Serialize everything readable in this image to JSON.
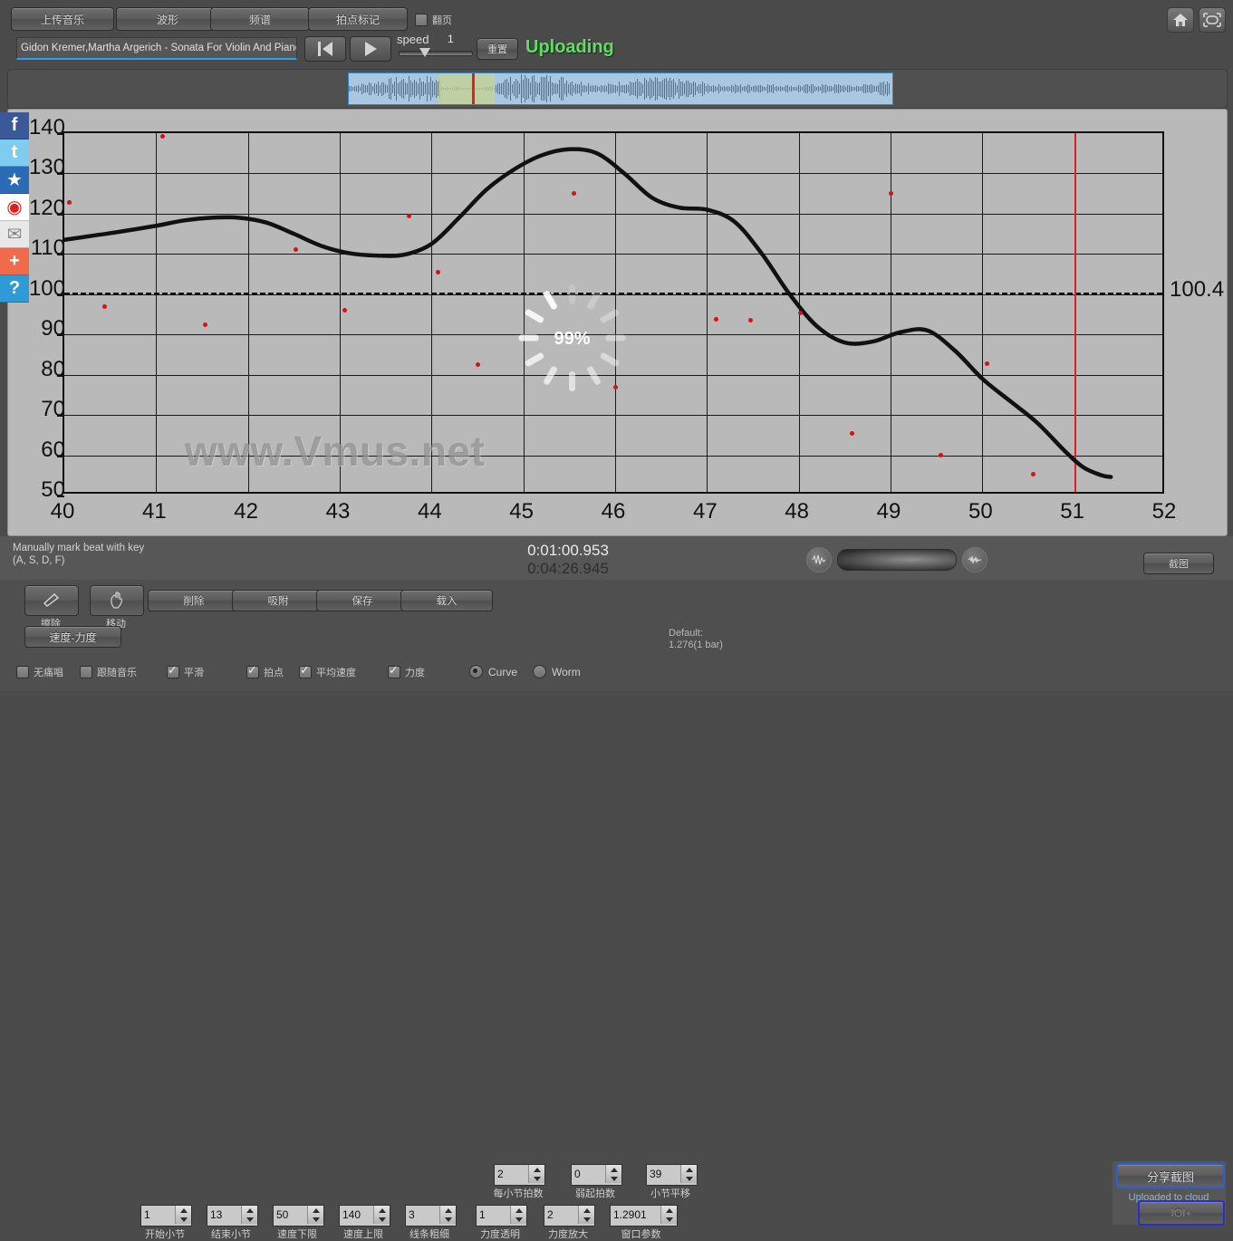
{
  "toolbar": {
    "buttons": [
      {
        "label": "上传音乐",
        "name": "upload-music-button"
      },
      {
        "label": "波形",
        "name": "waveform-button"
      },
      {
        "label": "频谱",
        "name": "spectrum-button"
      },
      {
        "label": "拍点标记",
        "name": "beat-mark-button"
      }
    ],
    "flip_page_checkbox": {
      "label": "翻页",
      "checked": false
    },
    "track_title": "Gidon Kremer,Martha Argerich - Sonata For Violin And Piano",
    "speed_label": "speed",
    "speed_value": "1",
    "reset_label": "重置",
    "status": "Uploading",
    "status_color": "#5ee05e",
    "home_icon": "home-icon",
    "fullscreen_icon": "fullscreen-icon"
  },
  "chart_data": {
    "type": "line",
    "title": "",
    "xlabel": "",
    "ylabel": "",
    "xlim": [
      40,
      52
    ],
    "ylim": [
      50,
      140
    ],
    "xticks": [
      40,
      41,
      42,
      43,
      44,
      45,
      46,
      47,
      48,
      49,
      50,
      51,
      52
    ],
    "yticks": [
      50,
      60,
      70,
      80,
      90,
      100,
      110,
      120,
      130,
      140
    ],
    "grid": true,
    "reference_line": {
      "value": 100.4,
      "label": "100.4",
      "style": "dashed"
    },
    "cursor_line": {
      "x": 51.0,
      "color": "#e02020"
    },
    "watermark": "www.Vmus.net",
    "progress_label": "99%",
    "series": [
      {
        "name": "tempo-curve",
        "type": "line",
        "color": "#111111",
        "points": [
          [
            40.0,
            113.5
          ],
          [
            40.3,
            114.5
          ],
          [
            40.6,
            115.5
          ],
          [
            41.0,
            117.0
          ],
          [
            41.3,
            118.3
          ],
          [
            41.6,
            119.0
          ],
          [
            41.9,
            119.0
          ],
          [
            42.2,
            117.8
          ],
          [
            42.5,
            115.0
          ],
          [
            42.8,
            112.0
          ],
          [
            43.1,
            110.2
          ],
          [
            43.4,
            109.6
          ],
          [
            43.7,
            109.8
          ],
          [
            44.0,
            112.5
          ],
          [
            44.3,
            119.0
          ],
          [
            44.6,
            126.0
          ],
          [
            44.9,
            131.0
          ],
          [
            45.2,
            134.5
          ],
          [
            45.5,
            136.0
          ],
          [
            45.8,
            135.0
          ],
          [
            46.1,
            130.0
          ],
          [
            46.4,
            124.0
          ],
          [
            46.7,
            121.5
          ],
          [
            47.0,
            121.0
          ],
          [
            47.3,
            118.0
          ],
          [
            47.6,
            110.0
          ],
          [
            47.9,
            100.0
          ],
          [
            48.2,
            92.0
          ],
          [
            48.5,
            88.0
          ],
          [
            48.8,
            88.2
          ],
          [
            49.1,
            90.5
          ],
          [
            49.4,
            91.0
          ],
          [
            49.7,
            86.0
          ],
          [
            50.0,
            79.0
          ],
          [
            50.3,
            73.5
          ],
          [
            50.6,
            68.0
          ],
          [
            50.9,
            61.0
          ],
          [
            51.1,
            57.0
          ],
          [
            51.3,
            55.0
          ],
          [
            51.4,
            54.6
          ]
        ]
      },
      {
        "name": "beat-points",
        "type": "scatter",
        "color": "#d81212",
        "points": [
          [
            40.05,
            122.8
          ],
          [
            40.44,
            97.0
          ],
          [
            41.07,
            139.2
          ],
          [
            41.53,
            92.5
          ],
          [
            42.52,
            111.0
          ],
          [
            43.05,
            96.0
          ],
          [
            43.75,
            119.5
          ],
          [
            44.07,
            105.5
          ],
          [
            44.5,
            82.5
          ],
          [
            45.55,
            125.0
          ],
          [
            46.0,
            76.8
          ],
          [
            47.1,
            93.8
          ],
          [
            47.48,
            93.5
          ],
          [
            48.02,
            95.3
          ],
          [
            48.58,
            65.5
          ],
          [
            49.0,
            125.0
          ],
          [
            49.55,
            60.0
          ],
          [
            50.05,
            82.8
          ],
          [
            50.55,
            55.2
          ]
        ]
      }
    ]
  },
  "waveform": {
    "selection_start_pct": 27.9,
    "selection_width_pct": 44.6,
    "playhead_pct": 38.0,
    "region_label": "waveform-overview"
  },
  "status": {
    "hint_line1": "Manually mark beat with key",
    "hint_line2": "(A, S, D, F)",
    "time_current": "0:01:00.953",
    "time_total": "0:04:26.945",
    "screenshot_label": "截图",
    "volume_icon_left": "waveform-icon",
    "volume_icon_right": "waveform-icon"
  },
  "bottom": {
    "tools": [
      {
        "label": "擦除",
        "icon": "eraser-icon",
        "name": "eraser-tool"
      },
      {
        "label": "移动",
        "icon": "hand-icon",
        "name": "move-tool"
      }
    ],
    "actions": [
      {
        "label": "削除",
        "name": "delete-button"
      },
      {
        "label": "吸附",
        "name": "snap-button"
      },
      {
        "label": "保存",
        "name": "save-button"
      },
      {
        "label": "载入",
        "name": "load-button"
      }
    ],
    "velocity_button": "速度-力度",
    "spinners": [
      {
        "value": "1",
        "caption": "开始小节",
        "name": "start-bar-spinner"
      },
      {
        "value": "13",
        "caption": "结束小节",
        "name": "end-bar-spinner"
      },
      {
        "value": "50",
        "caption": "速度下限",
        "name": "tempo-min-spinner"
      },
      {
        "value": "140",
        "caption": "速度上限",
        "name": "tempo-max-spinner"
      },
      {
        "value": "3",
        "caption": "线条粗细",
        "name": "line-width-spinner"
      },
      {
        "value": "1",
        "caption": "力度透明",
        "name": "velocity-alpha-spinner"
      },
      {
        "value": "2",
        "caption": "力度放大",
        "name": "velocity-zoom-spinner"
      },
      {
        "value": "1.2901",
        "caption": "窗口参数",
        "name": "window-param-spinner"
      }
    ],
    "top_spinners": [
      {
        "value": "2",
        "caption": "每小节拍数",
        "name": "beats-per-bar-spinner"
      },
      {
        "value": "0",
        "caption": "弱起拍数",
        "name": "pickup-beats-spinner"
      },
      {
        "value": "39",
        "caption": "小节平移",
        "name": "bar-offset-spinner"
      }
    ],
    "default_note_line1": "Default:",
    "default_note_line2": "1.276(1 bar)",
    "checkboxes": [
      {
        "label": "无痛唱",
        "checked": false,
        "name": "checkbox-no-pain"
      },
      {
        "label": "跟随音乐",
        "checked": false,
        "name": "checkbox-follow-music"
      },
      {
        "label": "平滑",
        "checked": true,
        "name": "checkbox-smooth"
      },
      {
        "label": "拍点",
        "checked": true,
        "name": "checkbox-beat"
      },
      {
        "label": "平均速度",
        "checked": true,
        "name": "checkbox-average-tempo"
      },
      {
        "label": "力度",
        "checked": true,
        "name": "checkbox-velocity"
      }
    ],
    "radios": [
      {
        "label": "Curve",
        "selected": true,
        "name": "radio-curve"
      },
      {
        "label": "Worm",
        "selected": false,
        "name": "radio-worm"
      }
    ],
    "share_label": "分享截图",
    "cloud_note": "Uploaded to cloud",
    "iol_label": "IOI+"
  },
  "social": [
    {
      "name": "facebook-icon",
      "glyph": "f",
      "bg": "#3b5998"
    },
    {
      "name": "twitter-icon",
      "glyph": "t",
      "bg": "#7ecdf0"
    },
    {
      "name": "qzone-icon",
      "glyph": "★",
      "bg": "#2b6bb5"
    },
    {
      "name": "weibo-icon",
      "glyph": "◉",
      "bg": "#e02020"
    },
    {
      "name": "email-icon",
      "glyph": "✉",
      "bg": "#e8e8e8"
    },
    {
      "name": "more-icon",
      "glyph": "+",
      "bg": "#ef6b4b"
    },
    {
      "name": "help-icon",
      "glyph": "?",
      "bg": "#2e9bd6"
    }
  ]
}
